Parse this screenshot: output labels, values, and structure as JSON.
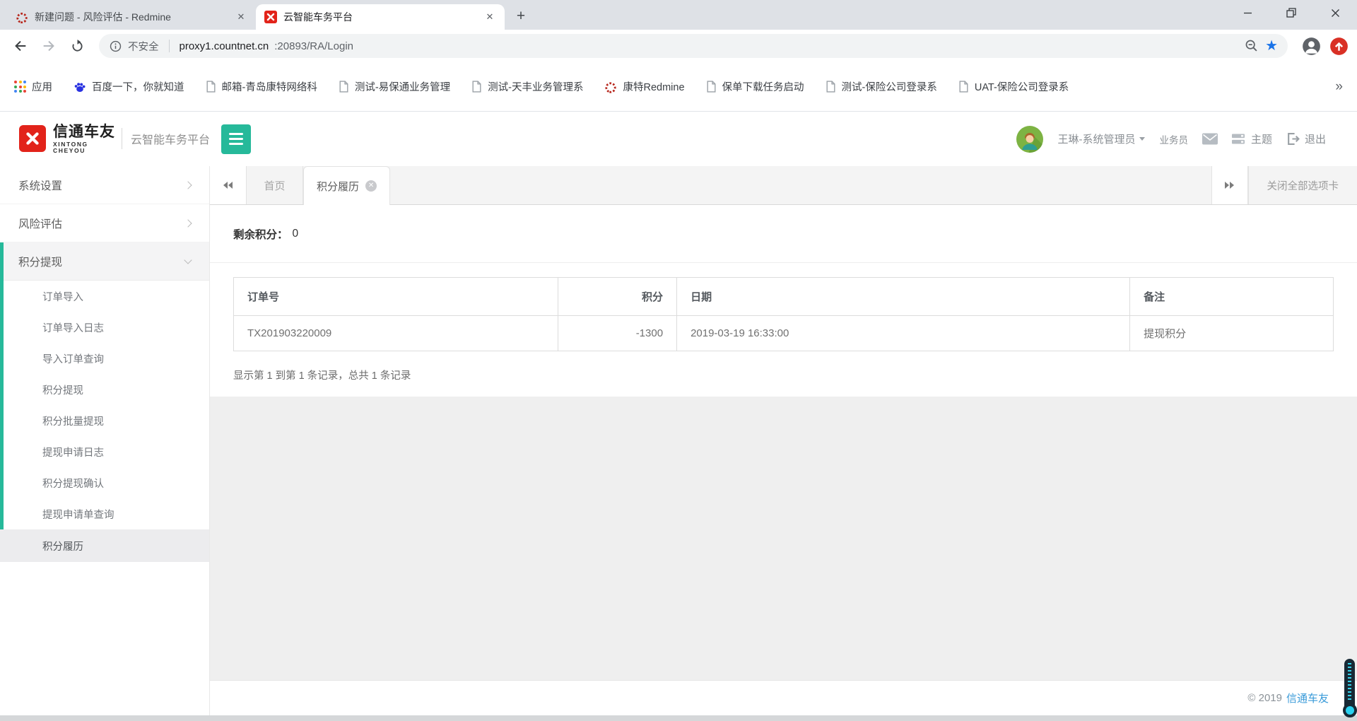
{
  "browser": {
    "tabs": [
      {
        "title": "新建问题 - 风险评估 - Redmine",
        "favicon": "redmine-icon",
        "active": false
      },
      {
        "title": "云智能车务平台",
        "favicon": "xintong-icon",
        "active": true
      }
    ],
    "address": {
      "security": "不安全",
      "host": "proxy1.countnet.cn",
      "path": ":20893/RA/Login"
    },
    "bookmarks": [
      {
        "label": "应用",
        "icon": "apps-grid-icon"
      },
      {
        "label": "百度一下，你就知道",
        "icon": "baidu-paw-icon"
      },
      {
        "label": "邮箱-青岛康特网络科",
        "icon": "page-icon"
      },
      {
        "label": "测试-易保通业务管理",
        "icon": "page-icon"
      },
      {
        "label": "测试-天丰业务管理系",
        "icon": "page-icon"
      },
      {
        "label": "康特Redmine",
        "icon": "redmine-icon"
      },
      {
        "label": "保单下载任务启动",
        "icon": "page-icon"
      },
      {
        "label": "测试-保险公司登录系",
        "icon": "page-icon"
      },
      {
        "label": "UAT-保险公司登录系",
        "icon": "page-icon"
      }
    ],
    "bookmarks_overflow": "»"
  },
  "app": {
    "logo": {
      "brand": "信通车友",
      "brand_sub": "XINTONG CHEYOU",
      "platform": "云智能车务平台"
    },
    "user": {
      "name": "王琳-系统管理员",
      "role": "业务员",
      "theme": "主题",
      "logout": "退出"
    },
    "sidebar": {
      "items": [
        {
          "label": "系统设置"
        },
        {
          "label": "风险评估"
        },
        {
          "label": "积分提现",
          "children": [
            "订单导入",
            "订单导入日志",
            "导入订单查询",
            "积分提现",
            "积分批量提现",
            "提现申请日志",
            "积分提现确认",
            "提现申请单查询",
            "积分履历"
          ],
          "active_child": "积分履历"
        }
      ]
    },
    "tabbar": {
      "home": "首页",
      "active": "积分履历",
      "close_all": "关闭全部选项卡"
    },
    "content": {
      "remaining_label": "剩余积分：",
      "remaining_value": "0",
      "table": {
        "headers": [
          "订单号",
          "积分",
          "日期",
          "备注"
        ],
        "rows": [
          [
            "TX201903220009",
            "-1300",
            "2019-03-19 16:33:00",
            "提现积分"
          ]
        ]
      },
      "summary": "显示第 1 到第 1 条记录，总共 1 条记录"
    },
    "footer": {
      "copyright": "© 2019",
      "brand_link": "信通车友"
    }
  },
  "colors": {
    "accent_teal": "#26b99a",
    "brand_red": "#e2231a",
    "link_blue": "#3a9bd9",
    "star_blue": "#1a73e8",
    "update_red": "#d93025"
  }
}
